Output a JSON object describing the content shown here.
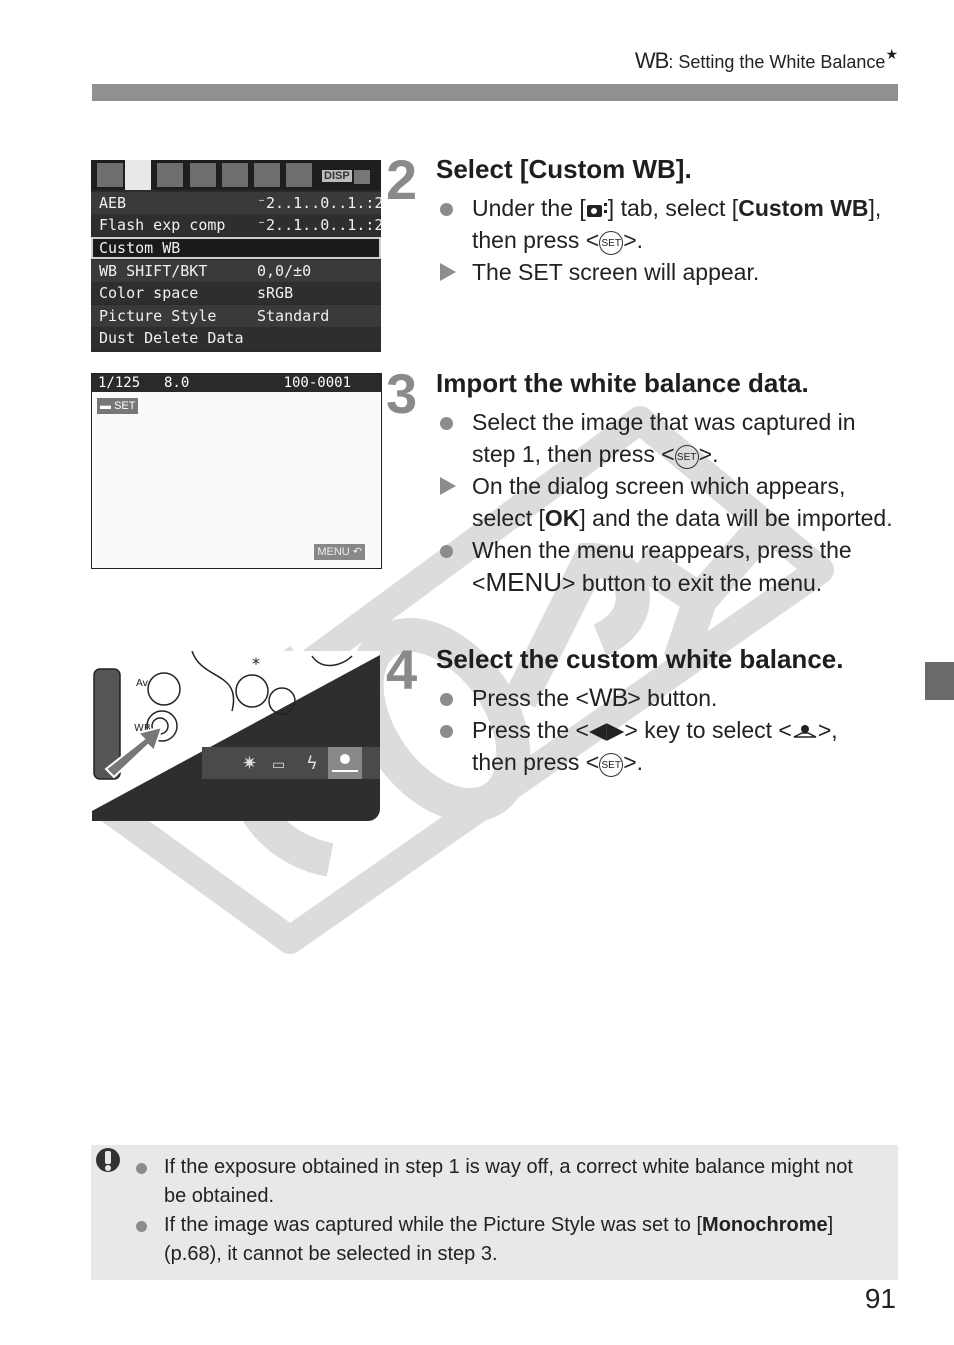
{
  "header": {
    "section_icon": "WB",
    "title": ": Setting the White Balance",
    "star": "★"
  },
  "steps": [
    {
      "number": "2",
      "title": "Select [Custom WB].",
      "items": [
        {
          "marker": "bullet",
          "parts": [
            "Under the [",
            "camera-tab-icon",
            "] tab, select [",
            "Custom WB",
            "], then press <",
            "set-button-icon",
            ">."
          ]
        },
        {
          "marker": "result",
          "text": "The SET screen will appear."
        }
      ]
    },
    {
      "number": "3",
      "title": "Import the white balance data.",
      "items": [
        {
          "marker": "bullet",
          "text_before": "Select the image that was captured in step 1, then press <",
          "text_after": ">."
        },
        {
          "marker": "result",
          "text_before": "On the dialog screen which appears, select [",
          "bold": "OK",
          "text_after": "] and the data will be imported."
        },
        {
          "marker": "bullet",
          "text_before": "When the menu reappears, press the <",
          "menu": "MENU",
          "text_after": "> button to exit the menu."
        }
      ]
    },
    {
      "number": "4",
      "title": "Select the custom white balance.",
      "items": [
        {
          "marker": "bullet",
          "text_before": "Press the <",
          "wb": "WB",
          "text_after": "> button."
        },
        {
          "marker": "bullet",
          "text_before": "Press the <",
          "keys": "◀▶",
          "text_mid": "> key to select <",
          "text_mid2": ">,",
          "text_after_line": "then press <",
          "text_end": ">."
        }
      ]
    }
  ],
  "set_icon_label": "SET",
  "lcd_menu": {
    "disp_label": "DISP",
    "rows": [
      {
        "label": "AEB",
        "value": "⁻2..1..0..1.:2"
      },
      {
        "label": "Flash exp comp",
        "value": "⁻2..1..0..1.:2"
      },
      {
        "label": "Custom WB",
        "value": "",
        "selected": true
      },
      {
        "label": "WB SHIFT/BKT",
        "value": "0,0/±0"
      },
      {
        "label": "Color space",
        "value": "sRGB"
      },
      {
        "label": "Picture Style",
        "value": "Standard"
      },
      {
        "label": "Dust Delete Data",
        "value": ""
      }
    ]
  },
  "lcd_set": {
    "shutter": "1/125",
    "aperture": "8.0",
    "file": "100-0001",
    "set_badge": "SET",
    "menu_badge": "MENU ↶"
  },
  "note": {
    "items": [
      {
        "text": "If the exposure obtained in step 1 is way off, a correct white balance might not be obtained."
      },
      {
        "text_before": "If the image was captured while the Picture Style was set to [",
        "bold": "Monochrome",
        "text_after": "] (p.68), it cannot be selected in step 3."
      }
    ]
  },
  "page_number": "91"
}
